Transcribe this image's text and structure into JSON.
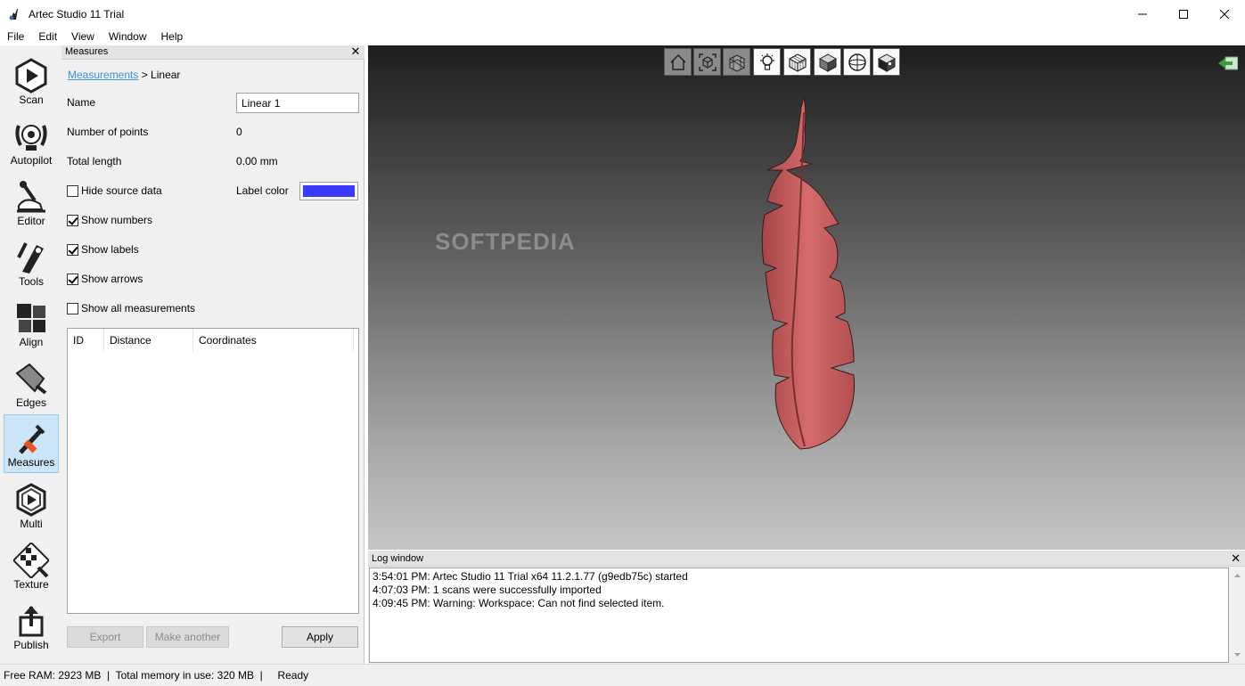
{
  "window": {
    "title": "Artec Studio 11 Trial"
  },
  "menu": [
    "File",
    "Edit",
    "View",
    "Window",
    "Help"
  ],
  "tools": [
    {
      "label": "Scan",
      "icon": "scan-icon"
    },
    {
      "label": "Autopilot",
      "icon": "autopilot-icon"
    },
    {
      "label": "Editor",
      "icon": "editor-icon"
    },
    {
      "label": "Tools",
      "icon": "tools-icon"
    },
    {
      "label": "Align",
      "icon": "align-icon"
    },
    {
      "label": "Edges",
      "icon": "edges-icon"
    },
    {
      "label": "Measures",
      "icon": "measures-icon",
      "active": true
    },
    {
      "label": "Multi",
      "icon": "multi-icon"
    },
    {
      "label": "Texture",
      "icon": "texture-icon"
    },
    {
      "label": "Publish",
      "icon": "publish-icon"
    }
  ],
  "panel": {
    "title": "Measures",
    "breadcrumb_link": "Measurements",
    "breadcrumb_rest": " > Linear",
    "name_label": "Name",
    "name_value": "Linear 1",
    "points_label": "Number of points",
    "points_value": "0",
    "length_label": "Total length",
    "length_value": "0.00 mm",
    "label_color_label": "Label color",
    "label_color": "#3b3bff",
    "checkboxes": [
      {
        "label": "Hide source data",
        "checked": false
      },
      {
        "label": "Show numbers",
        "checked": true
      },
      {
        "label": "Show labels",
        "checked": true
      },
      {
        "label": "Show arrows",
        "checked": true
      },
      {
        "label": "Show all measurements",
        "checked": false
      }
    ],
    "table_headers": [
      "ID",
      "Distance",
      "Coordinates"
    ],
    "export_label": "Export",
    "make_another_label": "Make another",
    "apply_label": "Apply"
  },
  "viewport": {
    "toolbar_icons": [
      "home-icon",
      "fit-cube-icon",
      "grid-icon",
      "light-bulb-icon",
      "wireframe-cube-icon",
      "solid-cube-icon",
      "sphere-icon",
      "texture-cube-icon"
    ],
    "model_color": "#c9585a",
    "watermark": "SOFTPEDIA"
  },
  "log": {
    "title": "Log window",
    "lines": [
      "3:54:01 PM: Artec Studio 11 Trial x64 11.2.1.77 (g9edb75c) started",
      "4:07:03 PM: 1 scans were successfully imported",
      "4:09:45 PM: Warning: Workspace: Can not find selected item."
    ]
  },
  "status": {
    "text": "Free RAM: 2923 MB  |  Total memory in use: 320 MB  |     Ready"
  }
}
